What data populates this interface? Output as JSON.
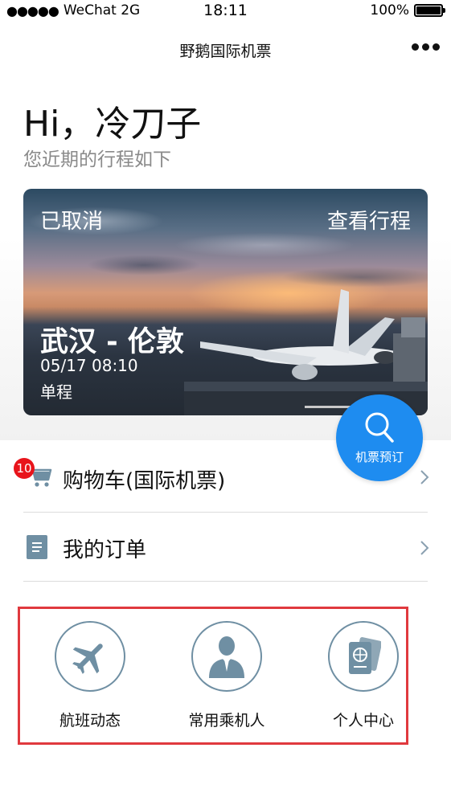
{
  "status_bar": {
    "signal": "●●●●●",
    "carrier": "WeChat 2G",
    "time": "18:11",
    "battery": "100%",
    "battery_level": 1.0
  },
  "navbar": {
    "title": "野鹅国际机票",
    "more_icon": "more-dots-icon"
  },
  "greeting": {
    "hello": "Hi，冷刀子",
    "subtitle": "您近期的行程如下"
  },
  "trip": {
    "status": "已取消",
    "view_link": "查看行程",
    "route": "武汉 - 伦敦",
    "datetime": "05/17 08:10",
    "type": "单程"
  },
  "fab": {
    "label": "机票预订",
    "icon": "search-icon",
    "color": "#1e8cf0"
  },
  "menu": {
    "cart": {
      "label": "购物车(国际机票)",
      "badge": "10",
      "icon": "cart-icon"
    },
    "orders": {
      "label": "我的订单",
      "icon": "document-icon"
    }
  },
  "quick_links": [
    {
      "label": "航班动态",
      "icon": "plane-icon"
    },
    {
      "label": "常用乘机人",
      "icon": "person-icon"
    },
    {
      "label": "个人中心",
      "icon": "passport-icon"
    }
  ],
  "colors": {
    "accent": "#1e8cf0",
    "badge": "#e8141b",
    "highlight_box": "#e0393e",
    "icon_gray": "#6f8fa3"
  }
}
